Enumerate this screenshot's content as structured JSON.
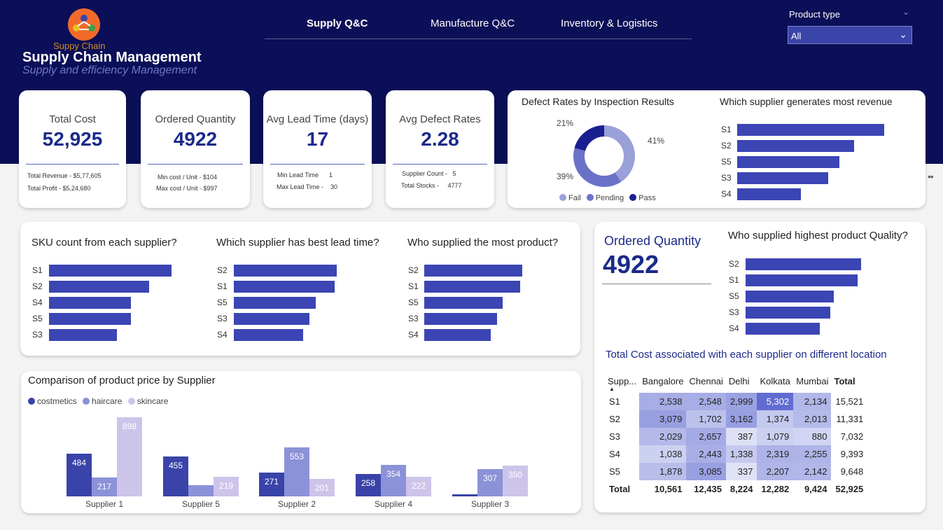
{
  "app": {
    "logo_text": "Suppy Chain",
    "title": "Supply Chain Management",
    "subtitle": "Supply and efficiency Management"
  },
  "nav": {
    "tabs": [
      {
        "label": "Supply Q&C",
        "active": true
      },
      {
        "label": "Manufacture Q&C",
        "active": false
      },
      {
        "label": "Inventory & Logistics",
        "active": false
      }
    ]
  },
  "filter": {
    "label": "Product type",
    "value": "All"
  },
  "kpis": [
    {
      "label": "Total Cost",
      "value": "52,925",
      "subs": [
        "Total Revenue -  $5,77,605",
        "Total Profit -  $5,24,680"
      ]
    },
    {
      "label": "Ordered Quantity",
      "value": "4922",
      "subs": [
        "Min cost / Unit -  $104",
        "Max cost / Unit -  $997"
      ]
    },
    {
      "label": "Avg Lead Time (days)",
      "value": "17",
      "subs": [
        "Min Lead Time      1",
        "Max Lead Time -    30"
      ]
    },
    {
      "label": "Avg Defect Rates",
      "value": "2.28",
      "subs": [
        "Supplier Count -   5",
        "Total Stocks -     4777"
      ]
    }
  ],
  "colors": {
    "navy": "#0b0f57",
    "bar": "#3b45b4",
    "cosmetics": "#3a43a8",
    "haircare": "#8b92d8",
    "skincare": "#cdc4ea"
  },
  "defect_donut": {
    "title": "Defect Rates by Inspection Results",
    "labels": {
      "pending": "41%",
      "fail": "39%",
      "pass": "21%"
    },
    "legend": [
      "Fail",
      "Pending",
      "Pass"
    ],
    "chart_data": {
      "type": "pie",
      "categories": [
        "Pending",
        "Fail",
        "Pass"
      ],
      "values": [
        41,
        39,
        21
      ]
    }
  },
  "charts": {
    "revenue": {
      "title": "Which supplier generates most revenue",
      "chart_data": {
        "type": "bar",
        "categories": [
          "S1",
          "S2",
          "S5",
          "S3",
          "S4"
        ],
        "values": [
          157528,
          125467,
          109486,
          97795,
          68083
        ]
      }
    },
    "sku": {
      "title": "SKU count from each supplier?",
      "chart_data": {
        "type": "bar",
        "categories": [
          "S1",
          "S2",
          "S4",
          "S5",
          "S3"
        ],
        "values": [
          27,
          22,
          18,
          18,
          15
        ]
      }
    },
    "leadtime": {
      "title": "Which supplier has best lead time?",
      "chart_data": {
        "type": "bar",
        "categories": [
          "S2",
          "S1",
          "S5",
          "S3",
          "S4"
        ],
        "values": [
          18.5,
          18.1,
          14.7,
          13.6,
          12.4
        ]
      }
    },
    "mostproduct": {
      "title": "Who supplied the most product?",
      "chart_data": {
        "type": "bar",
        "categories": [
          "S2",
          "S1",
          "S5",
          "S3",
          "S4"
        ],
        "values": [
          1050,
          1028,
          838,
          777,
          711
        ]
      }
    },
    "quality": {
      "title": "Who supplied highest product Quality?",
      "chart_data": {
        "type": "bar",
        "categories": [
          "S2",
          "S1",
          "S5",
          "S3",
          "S4"
        ],
        "values": [
          25.6,
          24.8,
          19.5,
          18.7,
          16.4
        ]
      }
    },
    "price": {
      "title": "Comparison of product price by Supplier",
      "legend": [
        "costmetics",
        "haircare",
        "skincare"
      ],
      "chart_data": {
        "type": "bar",
        "categories": [
          "Supplier 1",
          "Supplier 5",
          "Supplier 2",
          "Supplier 4",
          "Supplier 3"
        ],
        "series": [
          {
            "name": "costmetics",
            "values": [
              484,
              455,
              271,
              258,
              20
            ]
          },
          {
            "name": "haircare",
            "values": [
              217,
              129,
              553,
              354,
              307
            ]
          },
          {
            "name": "skincare",
            "values": [
              898,
              219,
              201,
              222,
              350
            ]
          }
        ],
        "labels": [
          [
            "484",
            "217",
            "898"
          ],
          [
            "455",
            "",
            "219"
          ],
          [
            "271",
            "553",
            "201"
          ],
          [
            "258",
            "354",
            "222"
          ],
          [
            "",
            "307",
            "350"
          ]
        ]
      }
    }
  },
  "ordered_quantity": {
    "title": "Ordered Quantity",
    "value": "4922"
  },
  "matrix": {
    "title": "Total Cost associated with each supplier on different location",
    "columns": [
      "Supp...",
      "Bangalore",
      "Chennai",
      "Delhi",
      "Kolkata",
      "Mumbai",
      "Total"
    ],
    "rows": [
      {
        "name": "S1",
        "cells": [
          "2,538",
          "2,548",
          "2,999",
          "5,302",
          "2,134"
        ],
        "raw": [
          2538,
          2548,
          2999,
          5302,
          2134
        ],
        "total": "15,521"
      },
      {
        "name": "S2",
        "cells": [
          "3,079",
          "1,702",
          "3,162",
          "1,374",
          "2,013"
        ],
        "raw": [
          3079,
          1702,
          3162,
          1374,
          2013
        ],
        "total": "11,331"
      },
      {
        "name": "S3",
        "cells": [
          "2,029",
          "2,657",
          "387",
          "1,079",
          "880"
        ],
        "raw": [
          2029,
          2657,
          387,
          1079,
          880
        ],
        "total": "7,032"
      },
      {
        "name": "S4",
        "cells": [
          "1,038",
          "2,443",
          "1,338",
          "2,319",
          "2,255"
        ],
        "raw": [
          1038,
          2443,
          1338,
          2319,
          2255
        ],
        "total": "9,393"
      },
      {
        "name": "S5",
        "cells": [
          "1,878",
          "3,085",
          "337",
          "2,207",
          "2,142"
        ],
        "raw": [
          1878,
          3085,
          337,
          2207,
          2142
        ],
        "total": "9,648"
      }
    ],
    "totals": {
      "label": "Total",
      "cells": [
        "10,561",
        "12,435",
        "8,224",
        "12,282",
        "9,424"
      ],
      "grand": "52,925"
    }
  }
}
